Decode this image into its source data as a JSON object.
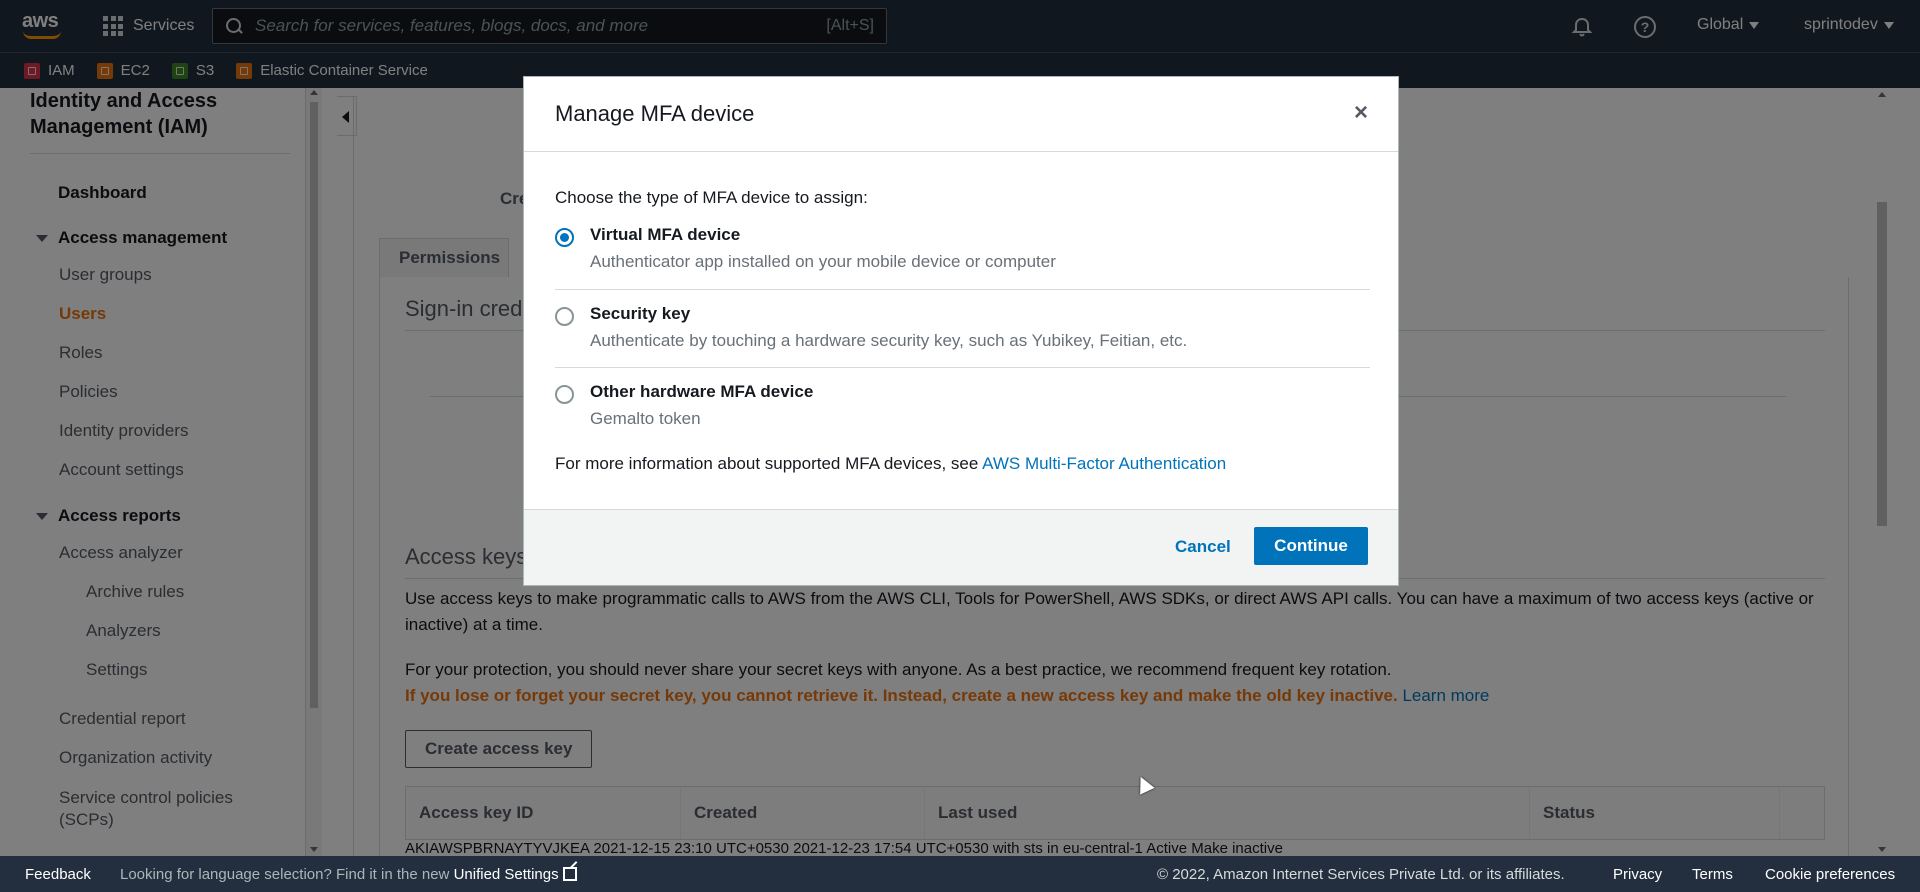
{
  "topnav": {
    "logo_text": "aws",
    "services_label": "Services",
    "search_placeholder": "Search for services, features, blogs, docs, and more",
    "search_shortcut": "[Alt+S]",
    "region_label": "Global",
    "account_label": "sprintodev"
  },
  "favorites": [
    {
      "label": "IAM",
      "color": "#dd344c"
    },
    {
      "label": "EC2",
      "color": "#ec7211"
    },
    {
      "label": "S3",
      "color": "#3f8624"
    },
    {
      "label": "Elastic Container Service",
      "color": "#ec7211"
    }
  ],
  "sidebar": {
    "title": "Identity and Access Management (IAM)",
    "dashboard": "Dashboard",
    "access_management": "Access management",
    "user_groups": "User groups",
    "users": "Users",
    "roles": "Roles",
    "policies": "Policies",
    "identity_providers": "Identity providers",
    "account_settings": "Account settings",
    "access_reports": "Access reports",
    "access_analyzer": "Access analyzer",
    "archive_rules": "Archive rules",
    "analyzers": "Analyzers",
    "settings": "Settings",
    "credential_report": "Credential report",
    "organization_activity": "Organization activity",
    "service_control_policies": "Service control policies (SCPs)"
  },
  "main": {
    "cre_fragment": "Cre",
    "tab_permissions": "Permissions",
    "signin_title": "Sign-in cred",
    "access_keys_title": "Access keys",
    "access_keys_desc": "Use access keys to make programmatic calls to AWS from the AWS CLI, Tools for PowerShell, AWS SDKs, or direct AWS API calls. You can have a maximum of two access keys (active or inactive) at a time.",
    "protection_text": "For your protection, you should never share your secret keys with anyone. As a best practice, we recommend frequent key rotation.",
    "warning_text": "If you lose or forget your secret key, you cannot retrieve it. Instead, create a new access key and make the old key inactive.",
    "learn_more": "Learn more",
    "create_key_button": "Create access key",
    "table_headers": [
      "Access key ID",
      "Created",
      "Last used",
      "Status"
    ],
    "table_row_fragment": "AKIAWSPBRNAYTYVJKEA        2021-12-15 23:10 UTC+0530        2021-12-23 17:54 UTC+0530 with sts in eu-central-1                                                              Active  Make inactive"
  },
  "modal": {
    "title": "Manage MFA device",
    "close_symbol": "×",
    "prompt": "Choose the type of MFA device to assign:",
    "options": [
      {
        "label": "Virtual MFA device",
        "desc": "Authenticator app installed on your mobile device or computer",
        "checked": true
      },
      {
        "label": "Security key",
        "desc": "Authenticate by touching a hardware security key, such as Yubikey, Feitian, etc.",
        "checked": false
      },
      {
        "label": "Other hardware MFA device",
        "desc": "Gemalto token",
        "checked": false
      }
    ],
    "info_text": "For more information about supported MFA devices, see",
    "info_link": "AWS Multi-Factor Authentication",
    "cancel_label": "Cancel",
    "continue_label": "Continue"
  },
  "footer": {
    "feedback": "Feedback",
    "language_text": "Looking for language selection? Find it in the new",
    "unified_settings": "Unified Settings",
    "copyright": "© 2022, Amazon Internet Services Private Ltd. or its affiliates.",
    "privacy": "Privacy",
    "terms": "Terms",
    "cookie_preferences": "Cookie preferences"
  }
}
